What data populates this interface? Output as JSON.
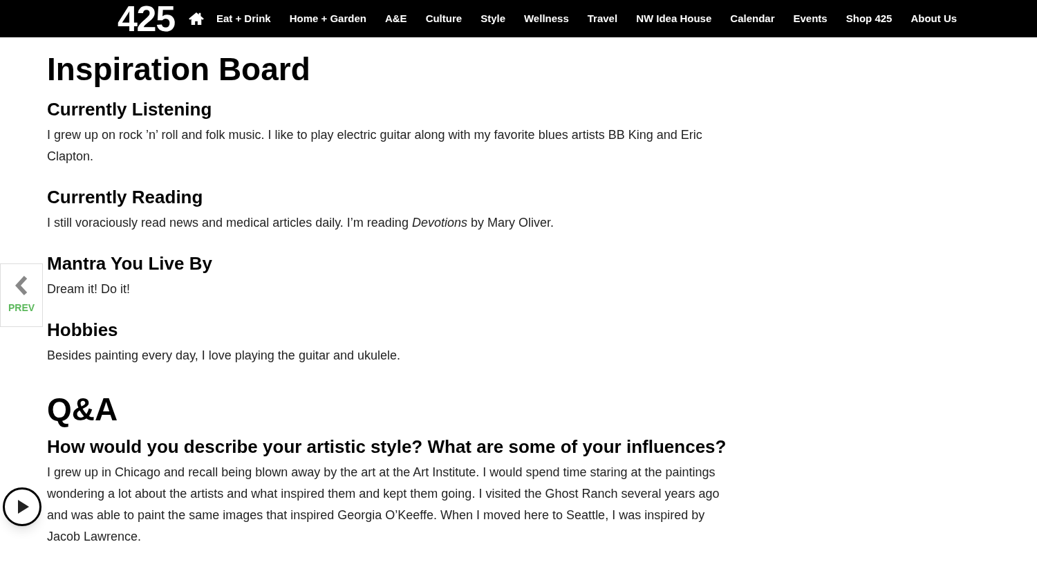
{
  "nav": {
    "logo": "425",
    "items": [
      {
        "label": "Eat + Drink"
      },
      {
        "label": "Home + Garden"
      },
      {
        "label": "A&E"
      },
      {
        "label": "Culture"
      },
      {
        "label": "Style"
      },
      {
        "label": "Wellness"
      },
      {
        "label": "Travel"
      },
      {
        "label": "NW Idea House"
      },
      {
        "label": "Calendar"
      },
      {
        "label": "Events"
      },
      {
        "label": "Shop 425"
      },
      {
        "label": "About Us"
      }
    ]
  },
  "title": "Inspiration Board",
  "sections": [
    {
      "heading": "Currently Listening",
      "text": "I grew up on rock ’n’ roll and folk music. I like to play electric guitar along with my favorite blues artists BB King and Eric Clapton."
    },
    {
      "heading": "Currently Reading",
      "text": "I still voraciously read news and medical articles daily. I’m reading *Devotions* by Mary Oliver."
    },
    {
      "heading": "Mantra You Live By",
      "text": "Dream it! Do it!"
    },
    {
      "heading": "Hobbies",
      "text": "Besides painting every day, I love playing the guitar and ukulele."
    }
  ],
  "qa": {
    "title": "Q&A",
    "items": [
      {
        "question": "How would you describe your artistic style? What are some of your influences?",
        "answer": "I grew up in Chicago and recall being blown away by the art at the Art Institute. I would spend time staring at the paintings wondering a lot about the artists and what inspired them and kept them going. I visited the Ghost Ranch several years ago and was able to paint the same images that inspired Georgia O’Keeffe. When I moved here to Seattle, I was inspired by Jacob Lawrence."
      }
    ]
  },
  "prev": {
    "label": "PREV"
  }
}
